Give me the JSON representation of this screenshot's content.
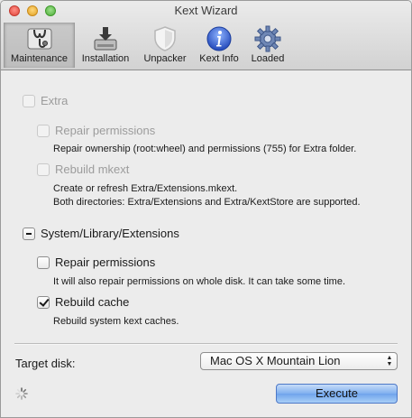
{
  "window": {
    "title": "Kext Wizard"
  },
  "toolbar": {
    "items": [
      {
        "label": "Maintenance",
        "icon": "stethoscope-icon",
        "selected": true
      },
      {
        "label": "Installation",
        "icon": "disk-install-icon",
        "selected": false
      },
      {
        "label": "Unpacker",
        "icon": "shield-icon",
        "selected": false
      },
      {
        "label": "Kext Info",
        "icon": "info-icon",
        "selected": false
      },
      {
        "label": "Loaded",
        "icon": "gear-icon",
        "selected": false
      }
    ]
  },
  "extra": {
    "label": "Extra",
    "enabled": false,
    "repair": {
      "label": "Repair permissions",
      "desc": "Repair ownership (root:wheel) and permissions (755) for Extra folder."
    },
    "rebuild": {
      "label": "Rebuild mkext",
      "desc1": "Create or refresh Extra/Extensions.mkext.",
      "desc2": "Both directories: Extra/Extensions and Extra/KextStore are supported."
    }
  },
  "system": {
    "label": "System/Library/Extensions",
    "state": "mixed",
    "repair": {
      "label": "Repair permissions",
      "checked": false,
      "desc": "It will also repair permissions on whole disk. It can take some time."
    },
    "rebuild": {
      "label": "Rebuild cache",
      "checked": true,
      "desc": "Rebuild system kext caches."
    }
  },
  "footer": {
    "target_label": "Target disk:",
    "target_value": "Mac OS X Mountain Lion",
    "execute_label": "Execute"
  },
  "colors": {
    "accent": "#4d78c7",
    "disabled_text": "#9c9c9c"
  }
}
